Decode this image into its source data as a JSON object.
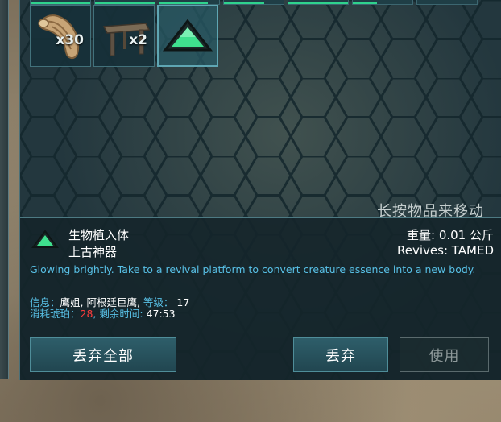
{
  "inventory": {
    "slots": [
      {
        "id": "wood",
        "quantity": "x30",
        "icon": "wood-log-icon"
      },
      {
        "id": "bench",
        "quantity": "x2",
        "icon": "wooden-bench-icon"
      },
      {
        "id": "implant",
        "quantity": "",
        "icon": "green-triangle-implant-icon",
        "selected": true
      }
    ],
    "hint": "长按物品来移动"
  },
  "details": {
    "name": "生物植入体",
    "subtitle": "上古神器",
    "weight": "重量: 0.01 公斤",
    "revives": "Revives: TAMED",
    "description": "Glowing brightly. Take to a revival platform to convert creature essence into a new body.",
    "info_label": "信息：",
    "info_value": "鹰姐, 阿根廷巨鹰, ",
    "level_label": "等级：",
    "level_value": "17",
    "amber_label": "消耗琥珀：",
    "amber_value": "28",
    "time_label": ", 剩余时间: ",
    "time_value": "47:53"
  },
  "buttons": {
    "drop_all": "丢弃全部",
    "drop": "丢弃",
    "use": "使用"
  },
  "colors": {
    "accent_green": "#2fd38d",
    "description_blue": "#58c0e6",
    "amber_red": "#ff3d3d"
  }
}
